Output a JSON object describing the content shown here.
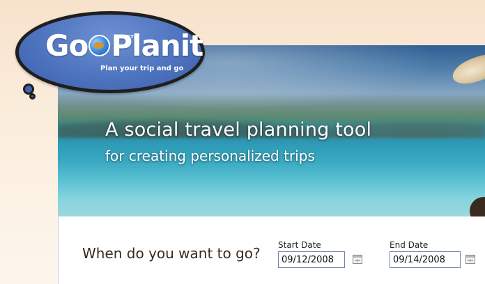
{
  "logo": {
    "name_part1": "Go",
    "name_part2": "Planit",
    "beta": "BETA",
    "tagline": "Plan your trip and go"
  },
  "hero": {
    "title": "A social travel planning tool",
    "subtitle": "for creating personalized trips"
  },
  "trip_form": {
    "question": "When do you want to go?",
    "start_date": {
      "label": "Start Date",
      "value": "09/12/2008"
    },
    "end_date": {
      "label": "End Date",
      "value": "09/14/2008"
    }
  },
  "icons": {
    "calendar": "calendar-icon",
    "globe": "globe-icon",
    "bubble": "thought-bubble"
  },
  "colors": {
    "logo_blue": "#4f74bf",
    "text_brown": "#3a2a1e",
    "input_border": "#6f87a8"
  }
}
